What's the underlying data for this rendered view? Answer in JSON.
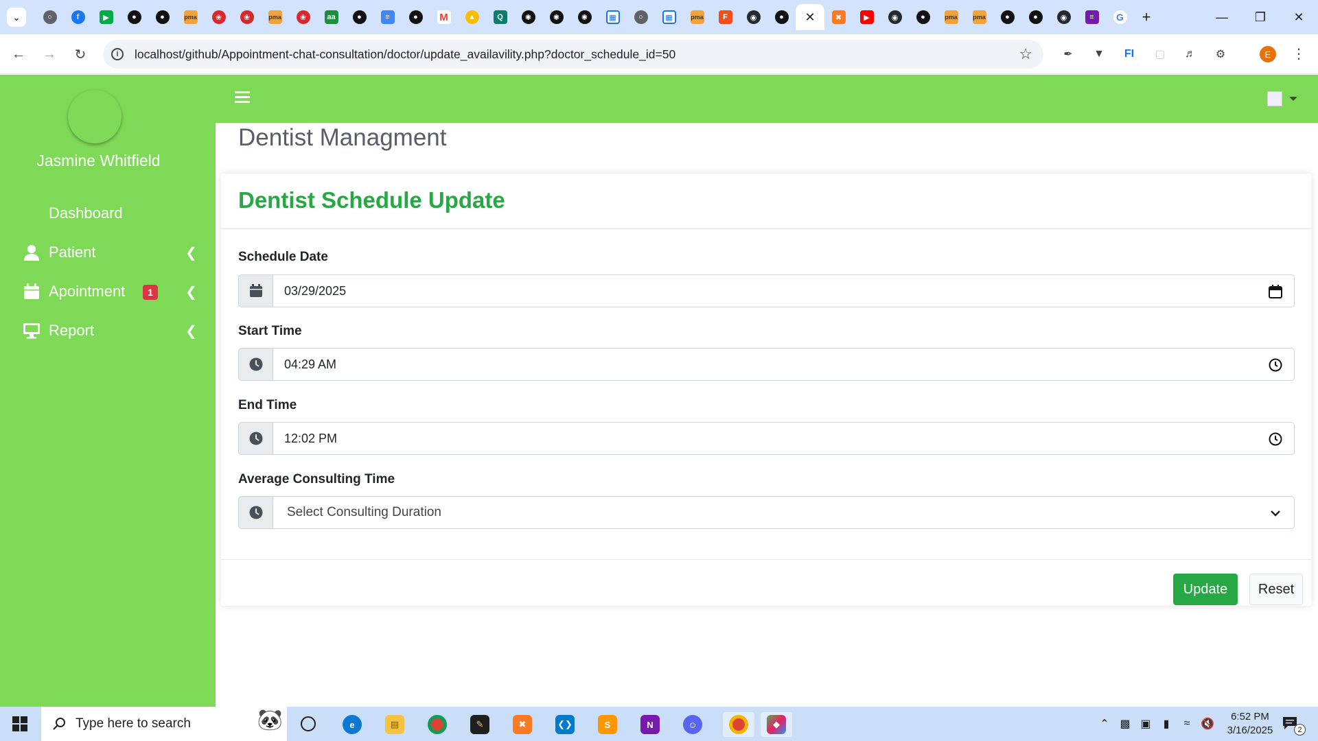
{
  "browser": {
    "url": "localhost/github/Appointment-chat-consultation/doctor/update_availavility.php?doctor_schedule_id=50",
    "profile_letter": "E",
    "tab_icons": [
      "globe",
      "facebook",
      "google-meet",
      "chatgpt",
      "chatgpt",
      "phpmyadmin",
      "huawei",
      "huawei",
      "phpmyadmin",
      "huawei",
      "aa",
      "chatgpt",
      "google-docs",
      "chatgpt",
      "gmail",
      "google-drive",
      "dashboard",
      "openai",
      "openai",
      "openai",
      "calendar",
      "globe",
      "calendar",
      "phpmyadmin",
      "figma",
      "github",
      "chatgpt",
      "close",
      "xampp",
      "youtube",
      "github",
      "chatgpt",
      "phpmyadmin",
      "phpmyadmin",
      "chatgpt",
      "chatgpt",
      "github",
      "onenote",
      "google"
    ]
  },
  "sidebar": {
    "user_name": "Jasmine Whitfield",
    "items": [
      {
        "label": "Dashboard"
      },
      {
        "label": "Patient"
      },
      {
        "label": "Apointment",
        "badge": "1"
      },
      {
        "label": "Report"
      }
    ]
  },
  "page": {
    "heading": "Dentist Managment"
  },
  "form": {
    "title": "Dentist Schedule Update",
    "schedule_date_label": "Schedule Date",
    "schedule_date_value": "03/29/2025",
    "start_time_label": "Start Time",
    "start_time_value": "04:29 AM",
    "end_time_label": "End Time",
    "end_time_value": "12:02 PM",
    "consulting_label": "Average Consulting Time",
    "consulting_value": "Select Consulting Duration",
    "update_label": "Update",
    "reset_label": "Reset"
  },
  "taskbar": {
    "search_placeholder": "Type here to search",
    "time": "6:52 PM",
    "date": "3/16/2025",
    "notification_count": "2"
  },
  "colors": {
    "sidebar": "#7ed957",
    "title_green": "#28a745",
    "badge_red": "#dc3545"
  }
}
